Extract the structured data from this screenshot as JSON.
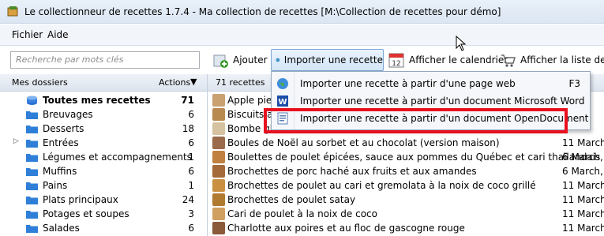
{
  "window": {
    "title": "Le collectionneur de recettes 1.7.4 - Ma collection de recettes [M:\\Collection de recettes pour démo]"
  },
  "menu": [
    "Fichier",
    "Aide"
  ],
  "search": {
    "placeholder": "Recherche par mots clés"
  },
  "toolbar": {
    "add": "Ajouter",
    "import": "Importer une recette",
    "calendar": "Afficher le calendrier",
    "list": "Afficher la liste de cou"
  },
  "calendar_icon_number": "12",
  "folders": {
    "header": "Mes dossiers",
    "actions": "Actions",
    "items": [
      {
        "name": "Toutes mes recettes",
        "count": "71"
      },
      {
        "name": "Breuvages",
        "count": "6"
      },
      {
        "name": "Desserts",
        "count": "18"
      },
      {
        "name": "Entrées",
        "count": "6"
      },
      {
        "name": "Légumes et accompagnements",
        "count": "1"
      },
      {
        "name": "Muffins",
        "count": "6"
      },
      {
        "name": "Pains",
        "count": "1"
      },
      {
        "name": "Plats principaux",
        "count": "24"
      },
      {
        "name": "Potages et soupes",
        "count": "3"
      },
      {
        "name": "Salades",
        "count": "6"
      }
    ]
  },
  "recipes": {
    "header": "71 recettes",
    "items": [
      {
        "name": "Apple pie (",
        "date": ""
      },
      {
        "name": "Biscuits a",
        "date": ""
      },
      {
        "name": "Bombe glacée à la mandarine",
        "date": ""
      },
      {
        "name": "Boules de Noël au sorbet et au chocolat (version maison)",
        "date": "11 March,"
      },
      {
        "name": "Boulettes de poulet épicées, sauce aux pommes du Québec et cari thaïlandais",
        "date": "6 March, 2"
      },
      {
        "name": "Brochettes de porc haché aux fruits et aux amandes",
        "date": "6 March, 2"
      },
      {
        "name": "Brochettes de poulet au cari et gremolata à la noix de coco grillé",
        "date": "11 March,"
      },
      {
        "name": "Brochettes de poulet satay",
        "date": "11 March,"
      },
      {
        "name": "Cari de poulet à la noix de coco",
        "date": "11 March,"
      },
      {
        "name": "Charlotte aux poires et au floc de gascogne rouge",
        "date": "11 March,"
      }
    ]
  },
  "dropdown": {
    "items": [
      {
        "label": "Importer une recette à partir d'une page web",
        "shortcut": "F3"
      },
      {
        "label": "Importer une recette à partir d'un document Microsoft Word",
        "shortcut": ""
      },
      {
        "label": "Importer une recette à partir d'un document OpenDocument",
        "shortcut": ""
      }
    ]
  },
  "colors": {
    "highlight": "#e8101f",
    "folder": "#2f7fd8",
    "title_bg": "#dbe6f3"
  }
}
